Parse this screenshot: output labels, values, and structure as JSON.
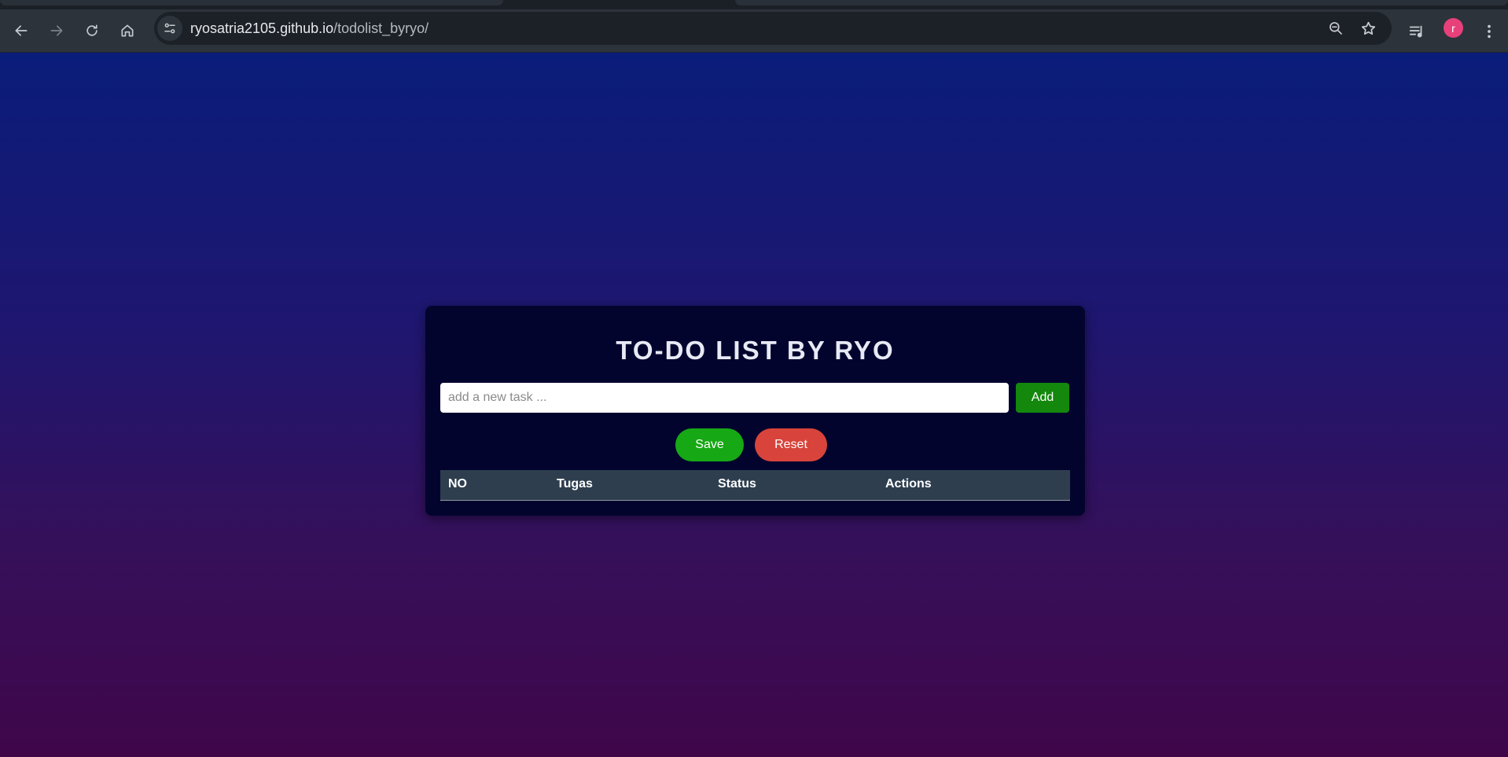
{
  "browser": {
    "url_host": "ryosatria2105.github.io",
    "url_path": "/todolist_byryo/",
    "profile_initial": "r",
    "profile_color": "#e8407a",
    "icons": [
      "back-arrow-icon",
      "forward-arrow-icon",
      "reload-icon",
      "home-icon",
      "site-info-icon",
      "zoom-out-icon",
      "bookmark-star-icon",
      "media-playlist-icon",
      "more-menu-icon"
    ]
  },
  "app": {
    "title": "TO-DO LIST BY RYO",
    "input_placeholder": "add a new task ...",
    "add_label": "Add",
    "save_label": "Save",
    "reset_label": "Reset",
    "table": {
      "columns": [
        "NO",
        "Tugas",
        "Status",
        "Actions"
      ],
      "rows": []
    }
  },
  "colors": {
    "gradient_top": "#0a1c7a",
    "gradient_bottom": "#40064a",
    "card_bg": "#03042e",
    "add_button": "#14870d",
    "save_button": "#17a815",
    "reset_button": "#d8443b",
    "table_header": "#2e3e4f"
  }
}
